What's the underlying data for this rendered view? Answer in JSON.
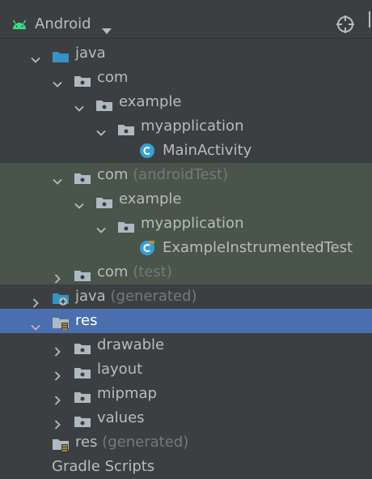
{
  "header": {
    "title": "Android",
    "icons": {
      "android": "android-icon",
      "dropdown": "chevron-down-icon",
      "locate": "crosshair-icon"
    }
  },
  "tree": [
    {
      "label": "java",
      "suffix": "",
      "level": 0,
      "expanded": true,
      "icon": "java-folder"
    },
    {
      "label": "com",
      "suffix": "",
      "level": 1,
      "expanded": true,
      "icon": "package"
    },
    {
      "label": "example",
      "suffix": "",
      "level": 2,
      "expanded": true,
      "icon": "package"
    },
    {
      "label": "myapplication",
      "suffix": "",
      "level": 3,
      "expanded": true,
      "icon": "package"
    },
    {
      "label": "MainActivity",
      "suffix": "",
      "level": 4,
      "expanded": null,
      "icon": "class"
    },
    {
      "label": "com",
      "suffix": "(androidTest)",
      "level": 1,
      "expanded": true,
      "icon": "package",
      "test": true
    },
    {
      "label": "example",
      "suffix": "",
      "level": 2,
      "expanded": true,
      "icon": "package",
      "test": true
    },
    {
      "label": "myapplication",
      "suffix": "",
      "level": 3,
      "expanded": true,
      "icon": "package",
      "test": true
    },
    {
      "label": "ExampleInstrumentedTest",
      "suffix": "",
      "level": 4,
      "expanded": null,
      "icon": "test-class",
      "test": true
    },
    {
      "label": "com",
      "suffix": "(test)",
      "level": 1,
      "expanded": false,
      "icon": "package",
      "test": true
    },
    {
      "label": "java",
      "suffix": "(generated)",
      "level": 0,
      "expanded": false,
      "icon": "generated-folder"
    },
    {
      "label": "res",
      "suffix": "",
      "level": 0,
      "expanded": true,
      "icon": "res-folder",
      "selected": true
    },
    {
      "label": "drawable",
      "suffix": "",
      "level": 1,
      "expanded": false,
      "icon": "package"
    },
    {
      "label": "layout",
      "suffix": "",
      "level": 1,
      "expanded": false,
      "icon": "package"
    },
    {
      "label": "mipmap",
      "suffix": "",
      "level": 1,
      "expanded": false,
      "icon": "package"
    },
    {
      "label": "values",
      "suffix": "",
      "level": 1,
      "expanded": false,
      "icon": "package"
    },
    {
      "label": "res",
      "suffix": "(generated)",
      "level": 0,
      "expanded": null,
      "icon": "res-folder"
    }
  ],
  "partial_row": {
    "label": "Gradle Scripts"
  },
  "colors": {
    "background": "#3c3f41",
    "selected": "#4b6eaf",
    "test_highlight": "#49544a",
    "folder_blue": "#3592c4",
    "package_gray": "#aeb9c0",
    "class_blue": "#389fd6"
  }
}
